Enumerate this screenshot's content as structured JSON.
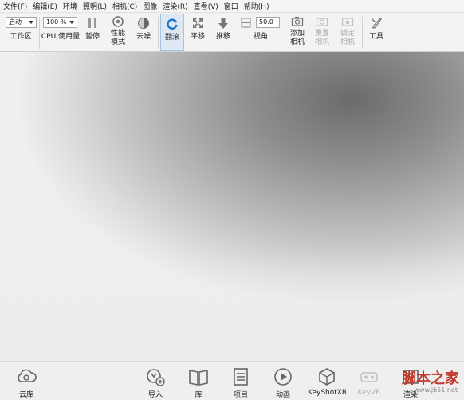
{
  "menu": [
    "文件(F)",
    "编辑(E)",
    "环境",
    "照明(L)",
    "相机(C)",
    "图像",
    "渲染(R)",
    "查看(V)",
    "窗口",
    "帮助(H)"
  ],
  "toolbar": {
    "workspace_value": "启动",
    "workspace_label": "工作区",
    "cpu_value": "100 %",
    "cpu_label": "CPU 使用量",
    "pause_label": "暂停",
    "perf_label_1": "性能",
    "perf_label_2": "模式",
    "denoise_label": "去噪",
    "tumble_label": "翻滚",
    "pan_label": "平移",
    "dolly_label": "推移",
    "fov_value": "50.0",
    "fov_label": "视角",
    "add_camera_1": "添加",
    "add_camera_2": "相机",
    "reset_camera_1": "重置",
    "reset_camera_2": "相机",
    "lock_camera_1": "锁定",
    "lock_camera_2": "相机",
    "tools_label": "工具"
  },
  "dock": {
    "cloud_label": "云库",
    "import_label": "导入",
    "library_label": "库",
    "project_label": "项目",
    "animation_label": "动画",
    "keyshotxr_label": "KeyShotXR",
    "keyvr_label": "KeyVR",
    "render_label": "渲染"
  },
  "watermark": {
    "text": "脚本之家",
    "url": "www.jb51.net"
  },
  "colors": {
    "accent": "#1f74c8",
    "active_bg": "#dde8f4"
  }
}
